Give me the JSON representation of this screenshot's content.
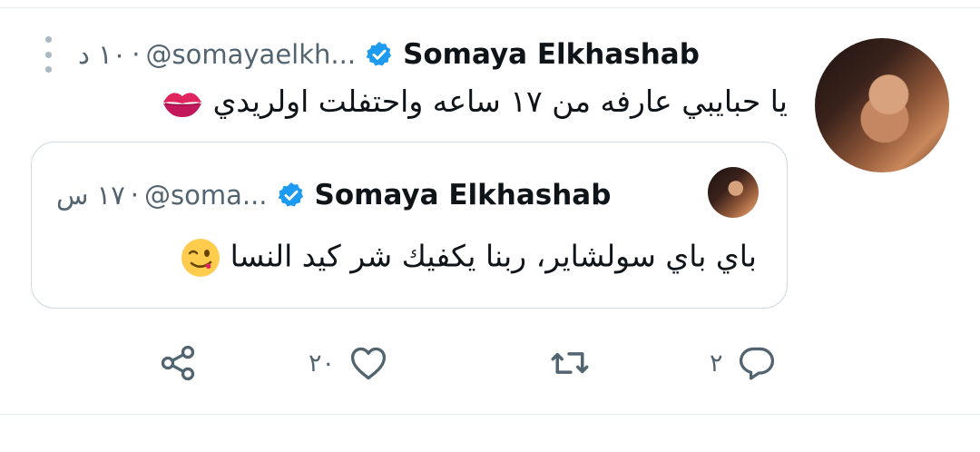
{
  "tweet": {
    "author_name": "Somaya Elkhashab",
    "handle": "@somayaelkh...",
    "separator": "·",
    "time": "١٠ د",
    "text": "يا حبايبي عارفه من ١٧ ساعه واحتفلت اولريدي",
    "emoji_icon": "lips-icon"
  },
  "quoted": {
    "author_name": "Somaya Elkhashab",
    "handle": "@soma...",
    "separator": "·",
    "time": "١٧ س",
    "text": "باي باي سولشاير، ربنا يكفيك شر كيد النسا",
    "emoji_icon": "winking-face-icon"
  },
  "actions": {
    "reply_count": "٢",
    "retweet_count": "",
    "like_count": "٢٠"
  },
  "colors": {
    "verified": "#1d9bf0",
    "secondary_text": "#536471",
    "border": "#cfd9de"
  }
}
